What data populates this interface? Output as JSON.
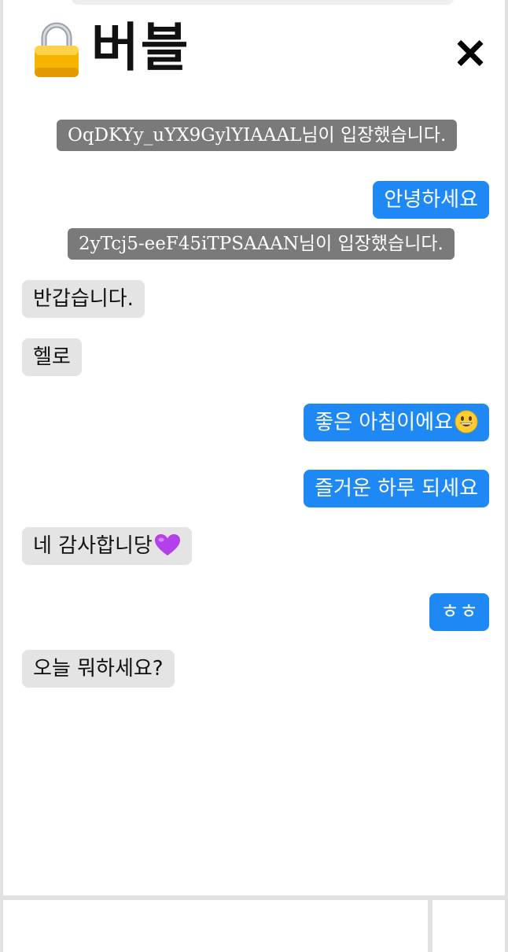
{
  "header": {
    "title": "버블",
    "close_symbol": "✕"
  },
  "messages": [
    {
      "kind": "system",
      "text": "OqDKYy_uYX9GylYIAAAL님이 입장했습니다."
    },
    {
      "kind": "mine",
      "text": "안녕하세요"
    },
    {
      "kind": "system",
      "text": "2yTcj5-eeF45iTPSAAAN님이 입장했습니다."
    },
    {
      "kind": "other",
      "text": "반갑습니다."
    },
    {
      "kind": "other",
      "text": "헬로"
    },
    {
      "kind": "mine",
      "text": "좋은 아침이에요",
      "emoji": "grinning-face"
    },
    {
      "kind": "mine",
      "text": "즐거운 하루 되세요"
    },
    {
      "kind": "other",
      "text": "네 감사합니당",
      "emoji": "purple-heart"
    },
    {
      "kind": "mine",
      "text": "ㅎㅎ"
    },
    {
      "kind": "other",
      "text": "오늘 뭐하세요?"
    }
  ],
  "composer": {
    "input_value": "",
    "send_label": ""
  },
  "colors": {
    "mine_bubble": "#1e88f5",
    "other_bubble": "#e4e4e4",
    "system_bubble": "#7a7a7a"
  }
}
